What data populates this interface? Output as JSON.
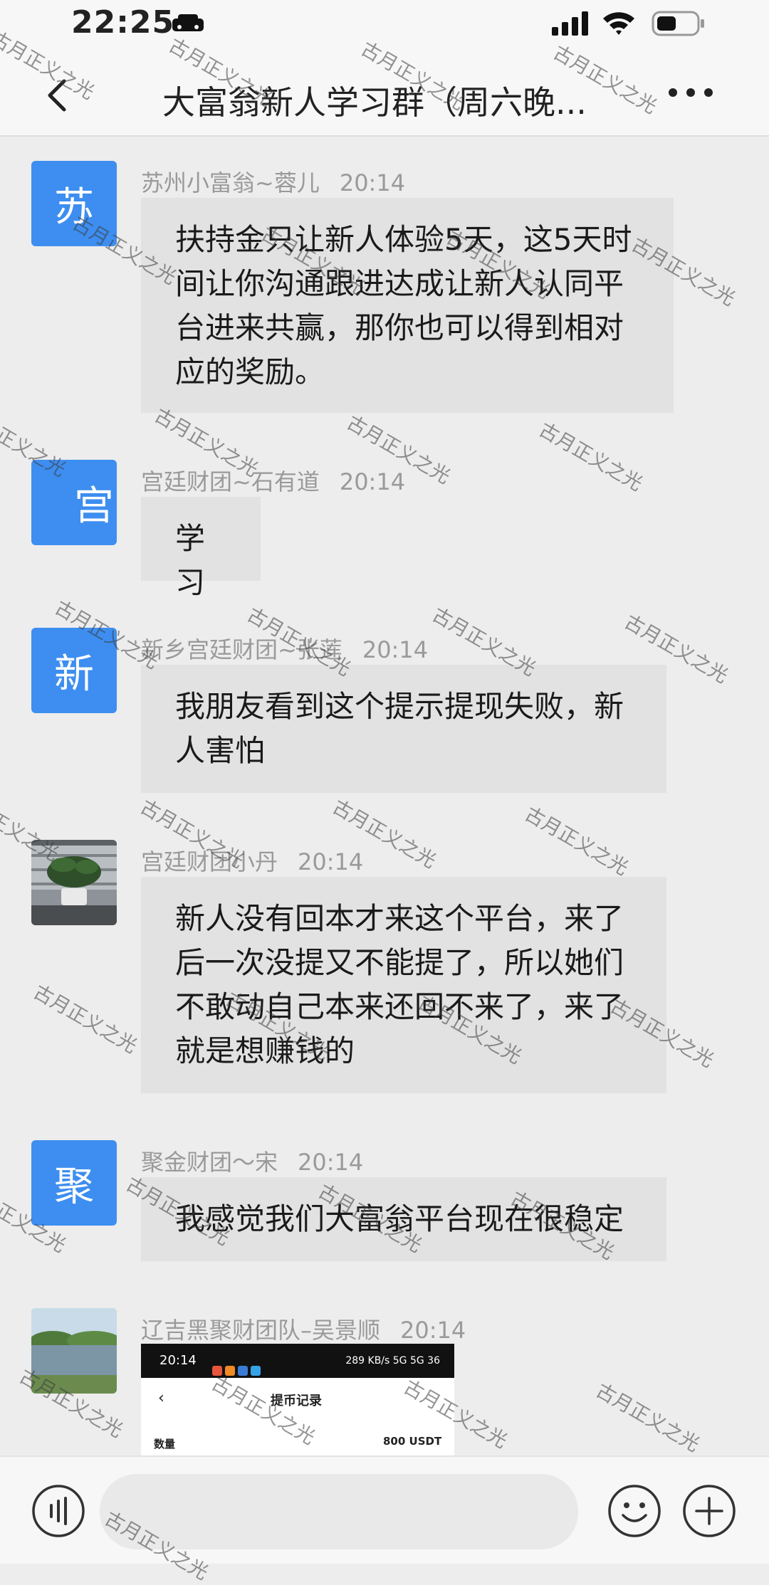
{
  "status_bar": {
    "time": "22:25"
  },
  "header": {
    "title": "大富翁新人学习群（周六晚..."
  },
  "messages": [
    {
      "avatar_text": "苏",
      "sender": "苏州小富翁~蓉儿",
      "time": "20:14",
      "text": "扶持金只让新人体验5天，这5天时间让你沟通跟进达成让新人认同平台进来共赢，那你也可以得到相对应的奖励。"
    },
    {
      "avatar_text": "宫",
      "sender": "宫廷财团~石有道",
      "time": "20:14",
      "text": "学习"
    },
    {
      "avatar_text": "新",
      "sender": "新乡宫廷财团~张莲",
      "time": "20:14",
      "text": "我朋友看到这个提示提现失败，新人害怕"
    },
    {
      "avatar_text": "",
      "sender": "宫廷财团小丹",
      "time": "20:14",
      "text": "新人没有回本才来这个平台，来了后一次没提又不能提了，所以她们不敢动自己本来还回不来了，来了就是想赚钱的"
    },
    {
      "avatar_text": "聚",
      "sender": "聚金财团～宋",
      "time": "20:14",
      "text": "我感觉我们大富翁平台现在很稳定"
    },
    {
      "avatar_text": "",
      "sender": "辽吉黑聚财团队–吴景顺",
      "time": "20:14",
      "text": ""
    }
  ],
  "image_message": {
    "status_time": "20:14",
    "status_right": "289 KB/s 5G 5G 36",
    "page_title": "提币记录",
    "row_label": "数量",
    "row_value": "800 USDT"
  },
  "watermark": "古月正义之光",
  "colors": {
    "avatar_blue": "#3d8ef0",
    "bubble": "#e2e2e2",
    "background": "#ededed"
  }
}
